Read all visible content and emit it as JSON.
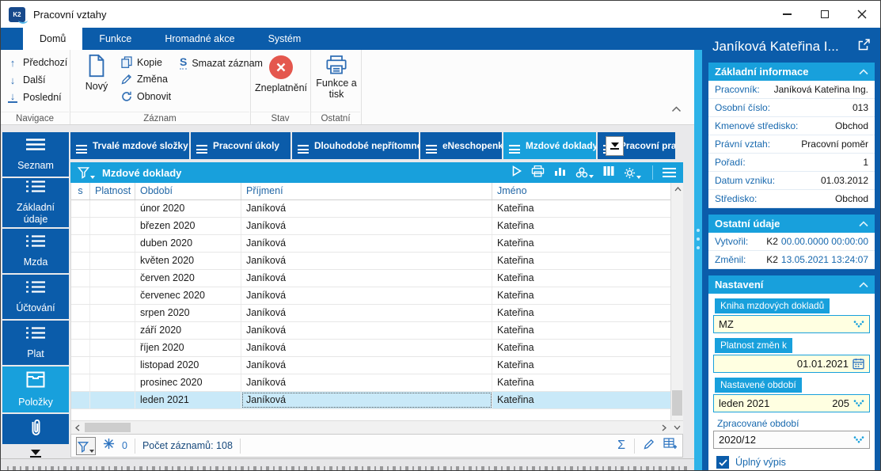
{
  "colors": {
    "dark_blue": "#0b5caa",
    "cyan_accent": "#18a0dc",
    "splitter_cyan": "#2db3e8",
    "selected_row": "#c9e9f8",
    "input_yellow": "#ffffe1",
    "danger_red": "#e4574e"
  },
  "titlebar": {
    "app_icon": "K2",
    "title": "Pracovní vztahy"
  },
  "ribbon": {
    "tabs": [
      {
        "label": "Domů",
        "active": true
      },
      {
        "label": "Funkce",
        "active": false
      },
      {
        "label": "Hromadné akce",
        "active": false
      },
      {
        "label": "Systém",
        "active": false
      }
    ],
    "nav_items": [
      "Předchozí",
      "Další",
      "Poslední"
    ],
    "record_big": "Nový",
    "record_items": [
      "Kopie",
      "Změna",
      "Obnovit"
    ],
    "delete_item": "Smazat záznam",
    "state_big": "Zneplatnění",
    "other_big": "Funkce a tisk",
    "group_labels": [
      "Navigace",
      "Záznam",
      "Stav",
      "Ostatní"
    ]
  },
  "sidebar": {
    "items": [
      {
        "label": "Seznam",
        "icon": "menu-icon",
        "active": false
      },
      {
        "label": "Základní údaje",
        "icon": "list-icon",
        "active": false
      },
      {
        "label": "Mzda",
        "icon": "list-icon",
        "active": false
      },
      {
        "label": "Účtování",
        "icon": "list-icon",
        "active": false
      },
      {
        "label": "Plat",
        "icon": "list-icon",
        "active": false
      },
      {
        "label": "Položky",
        "icon": "box-icon",
        "active": true
      },
      {
        "label": "",
        "icon": "paperclip-icon",
        "active": false
      }
    ]
  },
  "pagetabs": [
    {
      "label": "Trvalé mzdové složky",
      "active": false
    },
    {
      "label": "Pracovní úkoly",
      "active": false
    },
    {
      "label": "Dlouhodobé nepřítomnosti",
      "active": false
    },
    {
      "label": "eNeschopenky",
      "active": false
    },
    {
      "label": "Mzdové doklady",
      "active": true
    },
    {
      "label": "Pracovní praxe",
      "active": false
    }
  ],
  "grid": {
    "panel_title": "Mzdové doklady",
    "columns": [
      "s",
      "Platnost",
      "Období",
      "Příjmení",
      "Jméno"
    ],
    "rows": [
      {
        "s": "",
        "platnost": "",
        "obdobi": "únor 2020",
        "prijmeni": "Janíková",
        "jmeno": "Kateřina"
      },
      {
        "s": "",
        "platnost": "",
        "obdobi": "březen 2020",
        "prijmeni": "Janíková",
        "jmeno": "Kateřina"
      },
      {
        "s": "",
        "platnost": "",
        "obdobi": "duben 2020",
        "prijmeni": "Janíková",
        "jmeno": "Kateřina"
      },
      {
        "s": "",
        "platnost": "",
        "obdobi": "květen 2020",
        "prijmeni": "Janíková",
        "jmeno": "Kateřina"
      },
      {
        "s": "",
        "platnost": "",
        "obdobi": "červen 2020",
        "prijmeni": "Janíková",
        "jmeno": "Kateřina"
      },
      {
        "s": "",
        "platnost": "",
        "obdobi": "červenec 2020",
        "prijmeni": "Janíková",
        "jmeno": "Kateřina"
      },
      {
        "s": "",
        "platnost": "",
        "obdobi": "srpen 2020",
        "prijmeni": "Janíková",
        "jmeno": "Kateřina"
      },
      {
        "s": "",
        "platnost": "",
        "obdobi": "září 2020",
        "prijmeni": "Janíková",
        "jmeno": "Kateřina"
      },
      {
        "s": "",
        "platnost": "",
        "obdobi": "říjen 2020",
        "prijmeni": "Janíková",
        "jmeno": "Kateřina"
      },
      {
        "s": "",
        "platnost": "",
        "obdobi": "listopad 2020",
        "prijmeni": "Janíková",
        "jmeno": "Kateřina"
      },
      {
        "s": "",
        "platnost": "",
        "obdobi": "prosinec 2020",
        "prijmeni": "Janíková",
        "jmeno": "Kateřina"
      },
      {
        "s": "",
        "platnost": "",
        "obdobi": "leden 2021",
        "prijmeni": "Janíková",
        "jmeno": "Kateřina"
      }
    ],
    "selected_index": 11,
    "status": {
      "flag_count": "0",
      "record_count": "Počet záznamů: 108"
    }
  },
  "right_panel": {
    "title": "Janíková Kateřina I...",
    "basic_info": {
      "title": "Základní informace",
      "fields": [
        {
          "label": "Pracovník:",
          "value": "Janíková Kateřina Ing."
        },
        {
          "label": "Osobní číslo:",
          "value": "013"
        },
        {
          "label": "Kmenové středisko:",
          "value": "Obchod"
        },
        {
          "label": "Právní vztah:",
          "value": "Pracovní poměr"
        },
        {
          "label": "Pořadí:",
          "value": "1"
        },
        {
          "label": "Datum vzniku:",
          "value": "01.03.2012"
        },
        {
          "label": "Středisko:",
          "value": "Obchod"
        }
      ]
    },
    "other_info": {
      "title": "Ostatní údaje",
      "fields": [
        {
          "label": "Vytvořil:",
          "prefix": "K2",
          "value": "00.00.0000 00:00:00"
        },
        {
          "label": "Změnil:",
          "prefix": "K2",
          "value": "13.05.2021 13:24:07"
        }
      ]
    },
    "settings": {
      "title": "Nastavení",
      "book_label": "Kniha mzdových dokladů",
      "book_value": "MZ",
      "validity_label": "Platnost změn k",
      "validity_value": "01.01.2021",
      "period_label": "Nastavené období",
      "period_value": "leden 2021",
      "period_number": "205",
      "processed_label": "Zpracované období",
      "processed_value": "2020/12",
      "full_list_label": "Úplný výpis",
      "full_list_checked": true
    }
  }
}
